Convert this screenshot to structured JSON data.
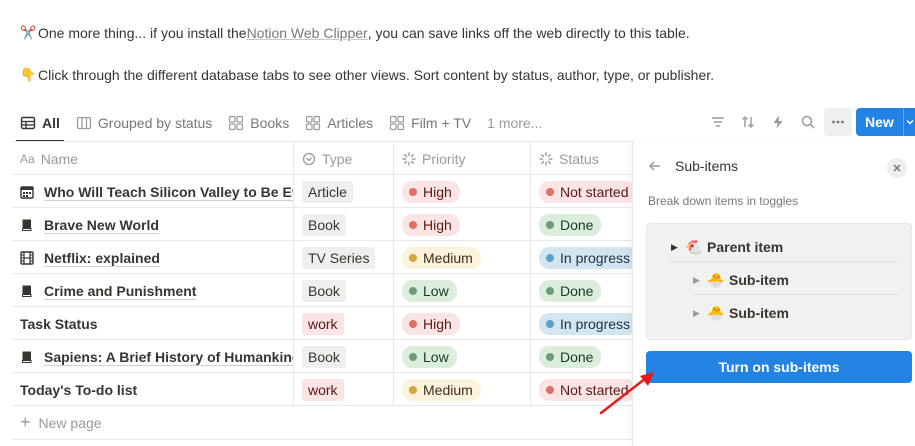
{
  "callouts": {
    "clipper": {
      "emoji": "✂️",
      "before": "One more thing... if you install the ",
      "link": "Notion Web Clipper",
      "after": ", you can save links off the web directly to this table."
    },
    "tabs_tip": {
      "emoji": "👇",
      "text": "Click through the different database tabs to see other views. Sort content by status, author, type, or publisher."
    }
  },
  "tabs": [
    {
      "label": "All",
      "icon": "table-icon",
      "active": true
    },
    {
      "label": "Grouped by status",
      "icon": "board-icon",
      "active": false
    },
    {
      "label": "Books",
      "icon": "gallery-icon",
      "active": false
    },
    {
      "label": "Articles",
      "icon": "gallery-icon",
      "active": false
    },
    {
      "label": "Film + TV",
      "icon": "gallery-icon",
      "active": false
    }
  ],
  "tabs_more": "1 more...",
  "toolbar": {
    "new_label": "New",
    "icons": [
      "filter-icon",
      "sort-icon",
      "lightning-icon",
      "search-icon",
      "more-icon"
    ]
  },
  "table": {
    "headers": {
      "name": "Name",
      "type": "Type",
      "priority": "Priority",
      "status": "Status"
    },
    "rows": [
      {
        "name": "Who Will Teach Silicon Valley to Be Ethical?",
        "icon": "calendar-icon",
        "type": "Article",
        "type_color": "gray",
        "priority": "High",
        "priority_color": "red",
        "status": "Not started",
        "status_color": "red"
      },
      {
        "name": "Brave New World",
        "icon": "book-icon",
        "type": "Book",
        "type_color": "gray",
        "priority": "High",
        "priority_color": "red",
        "status": "Done",
        "status_color": "green"
      },
      {
        "name": "Netflix: explained",
        "icon": "film-icon",
        "type": "TV Series",
        "type_color": "gray",
        "priority": "Medium",
        "priority_color": "yellow",
        "status": "In progress",
        "status_color": "blue"
      },
      {
        "name": "Crime and Punishment",
        "icon": "book-icon",
        "type": "Book",
        "type_color": "gray",
        "priority": "Low",
        "priority_color": "green",
        "status": "Done",
        "status_color": "green"
      },
      {
        "name": "Task Status",
        "icon": "",
        "type": "work",
        "type_color": "red",
        "priority": "High",
        "priority_color": "red",
        "status": "In progress",
        "status_color": "blue"
      },
      {
        "name": "Sapiens: A Brief History of Humankind",
        "icon": "book-icon",
        "type": "Book",
        "type_color": "gray",
        "priority": "Low",
        "priority_color": "green",
        "status": "Done",
        "status_color": "green"
      },
      {
        "name": "Today's To-do list",
        "icon": "",
        "type": "work",
        "type_color": "red",
        "priority": "Medium",
        "priority_color": "yellow",
        "status": "Not started",
        "status_color": "red"
      }
    ],
    "new_page": "New page"
  },
  "panel": {
    "title": "Sub-items",
    "description": "Break down items in toggles",
    "preview": {
      "parent": {
        "emoji": "🐔",
        "label": "Parent item"
      },
      "children": [
        {
          "emoji": "🐣",
          "label": "Sub-item"
        },
        {
          "emoji": "🐣",
          "label": "Sub-item"
        }
      ]
    },
    "button_label": "Turn on sub-items"
  },
  "colors": {
    "accent": "#2383e2",
    "annotation_arrow": "#e8191a"
  }
}
